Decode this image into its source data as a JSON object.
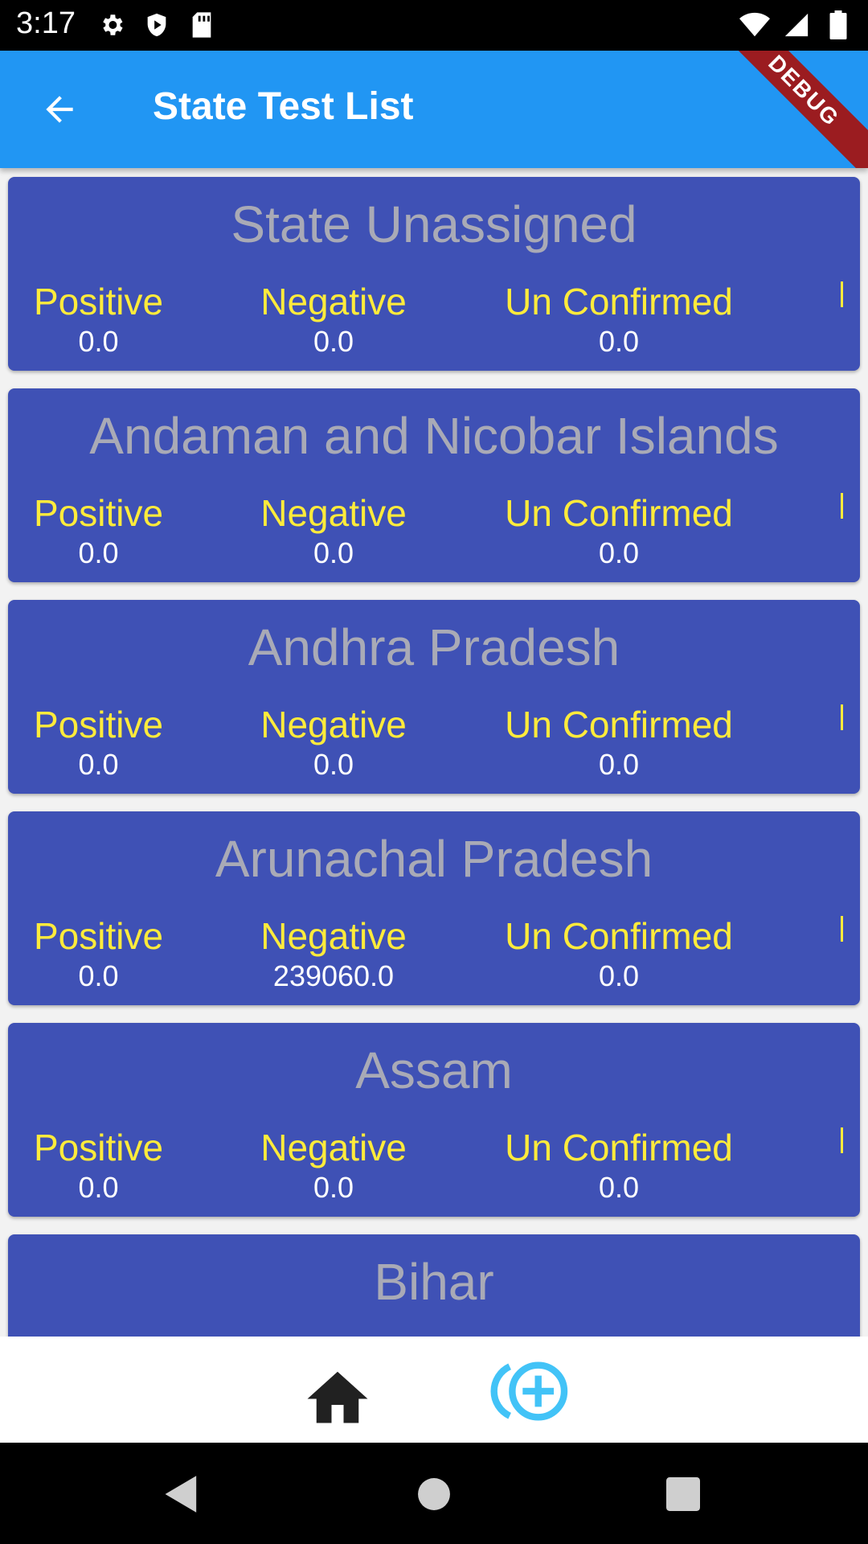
{
  "status_bar": {
    "time": "3:17"
  },
  "app_bar": {
    "title": "State Test List",
    "debug_label": "DEBUG"
  },
  "labels": {
    "positive": "Positive",
    "negative": "Negative",
    "unconfirmed": "Un Confirmed"
  },
  "cards": [
    {
      "name": "State Unassigned",
      "positive": "0.0",
      "negative": "0.0",
      "unconfirmed": "0.0"
    },
    {
      "name": "Andaman and Nicobar Islands",
      "positive": "0.0",
      "negative": "0.0",
      "unconfirmed": "0.0"
    },
    {
      "name": "Andhra Pradesh",
      "positive": "0.0",
      "negative": "0.0",
      "unconfirmed": "0.0"
    },
    {
      "name": "Arunachal Pradesh",
      "positive": "0.0",
      "negative": "239060.0",
      "unconfirmed": "0.0"
    },
    {
      "name": "Assam",
      "positive": "0.0",
      "negative": "0.0",
      "unconfirmed": "0.0"
    },
    {
      "name": "Bihar"
    }
  ],
  "colors": {
    "app_bar": "#2196f3",
    "card": "#3f51b5",
    "label": "#ffeb3b",
    "title": "#a9aab6",
    "add_icon": "#42c3f7"
  },
  "icons": {
    "back": "arrow-back-icon",
    "home": "home-icon",
    "add": "add-circle-icon"
  }
}
